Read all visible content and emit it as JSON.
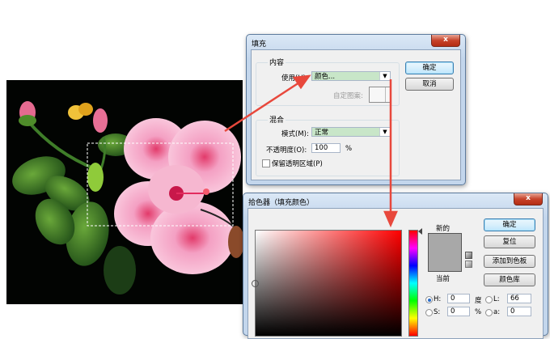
{
  "fill_dialog": {
    "title": "填充",
    "close_glyph": "x",
    "content_group": "内容",
    "use_label": "使用(U):",
    "use_value": "颜色...",
    "custom_pattern_label": "自定图案:",
    "blend_group": "混合",
    "mode_label": "模式(M):",
    "mode_value": "正常",
    "opacity_label": "不透明度(O):",
    "opacity_value": "100",
    "opacity_unit": "%",
    "preserve_label": "保留透明区域(P)",
    "ok_button": "确定",
    "cancel_button": "取消"
  },
  "picker_dialog": {
    "title": "拾色器（填充颜色）",
    "close_glyph": "x",
    "new_label": "新的",
    "current_label": "当前",
    "ok_button": "确定",
    "reset_button": "复位",
    "add_swatch_button": "添加到色板",
    "libraries_button": "颜色库",
    "fields": [
      {
        "label": "H:",
        "value": "0",
        "unit": "度",
        "selected": true
      },
      {
        "label": "S:",
        "value": "0",
        "unit": "%",
        "selected": false
      },
      {
        "label": "L:",
        "value": "66",
        "unit": "",
        "selected": false
      },
      {
        "label": "a:",
        "value": "0",
        "unit": "",
        "selected": false
      }
    ],
    "new_color": "#a8a8a8",
    "current_color": "#a8a8a8"
  },
  "colors": {
    "arrow": "#e8483c",
    "combo_highlight": "#c8e6c8",
    "photo_bg": "#020402",
    "hibiscus": "#f5a9c8"
  }
}
